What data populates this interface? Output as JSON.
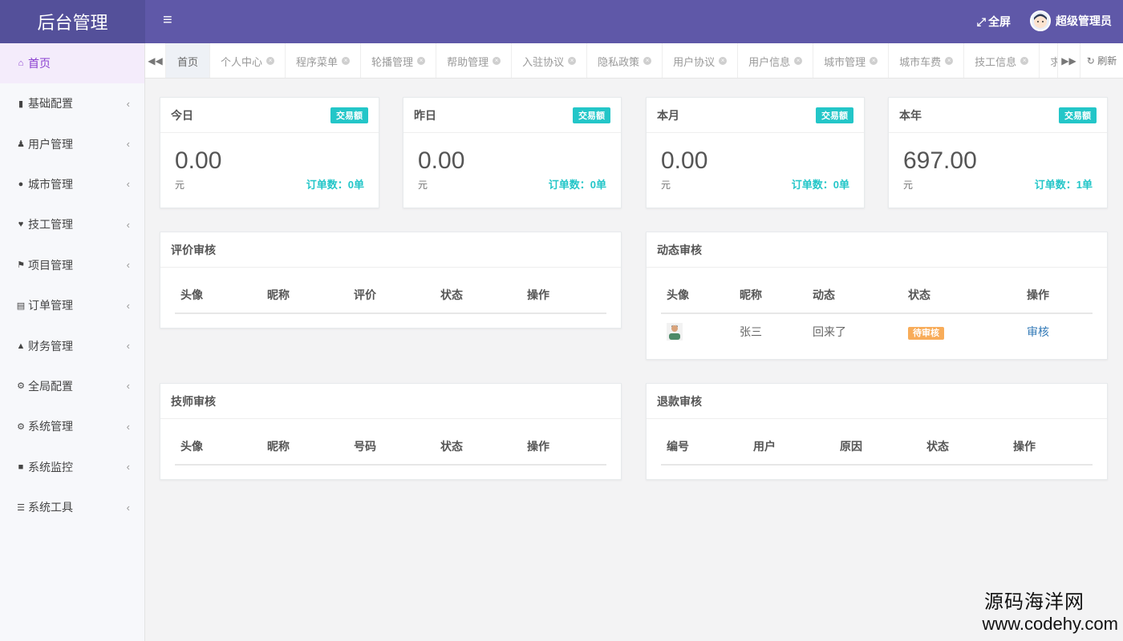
{
  "app": {
    "title": "后台管理",
    "fullscreen_label": "全屏",
    "user_name": "超级管理员",
    "menu_icon": "hamburger-icon"
  },
  "sidebar": {
    "items": [
      {
        "label": "首页",
        "icon": "home-icon",
        "active": true
      },
      {
        "label": "基础配置",
        "icon": "bookmark-icon"
      },
      {
        "label": "用户管理",
        "icon": "user-icon"
      },
      {
        "label": "城市管理",
        "icon": "globe-icon"
      },
      {
        "label": "技工管理",
        "icon": "heart-icon"
      },
      {
        "label": "项目管理",
        "icon": "tag-icon"
      },
      {
        "label": "订单管理",
        "icon": "bar-chart-icon"
      },
      {
        "label": "财务管理",
        "icon": "area-chart-icon"
      },
      {
        "label": "全局配置",
        "icon": "cogs-icon"
      },
      {
        "label": "系统管理",
        "icon": "gear-icon"
      },
      {
        "label": "系统监控",
        "icon": "video-icon"
      },
      {
        "label": "系统工具",
        "icon": "list-icon"
      }
    ]
  },
  "tabs": {
    "items": [
      "首页",
      "个人中心",
      "程序菜单",
      "轮播管理",
      "帮助管理",
      "入驻协议",
      "隐私政策",
      "用户协议",
      "用户信息",
      "城市管理",
      "城市车费",
      "技工信息",
      "求救报警"
    ],
    "refresh_label": "刷新"
  },
  "stats": [
    {
      "title": "今日",
      "badge": "交易额",
      "value": "0.00",
      "unit": "元",
      "orders": "订单数：0单"
    },
    {
      "title": "昨日",
      "badge": "交易额",
      "value": "0.00",
      "unit": "元",
      "orders": "订单数：0单"
    },
    {
      "title": "本月",
      "badge": "交易额",
      "value": "0.00",
      "unit": "元",
      "orders": "订单数：0单"
    },
    {
      "title": "本年",
      "badge": "交易额",
      "value": "697.00",
      "unit": "元",
      "orders": "订单数：1单"
    }
  ],
  "review_comments": {
    "title": "评价审核",
    "columns": [
      "头像",
      "昵称",
      "评价",
      "状态",
      "操作"
    ]
  },
  "review_posts": {
    "title": "动态审核",
    "columns": [
      "头像",
      "昵称",
      "动态",
      "状态",
      "操作"
    ],
    "rows": [
      {
        "nickname": "张三",
        "post": "回来了",
        "status": "待审核",
        "action": "审核"
      }
    ]
  },
  "review_techs": {
    "title": "技师审核",
    "columns": [
      "头像",
      "昵称",
      "号码",
      "状态",
      "操作"
    ]
  },
  "review_refunds": {
    "title": "退款审核",
    "columns": [
      "编号",
      "用户",
      "原因",
      "状态",
      "操作"
    ]
  },
  "watermark": {
    "line1": "源码海洋网",
    "line2": "www.codehy.com"
  },
  "colors": {
    "header": "#5f58a8",
    "logo_bg": "#54509a",
    "accent_teal": "#23c6c8",
    "pending_orange": "#f8ac59",
    "link_blue": "#337ab7"
  }
}
